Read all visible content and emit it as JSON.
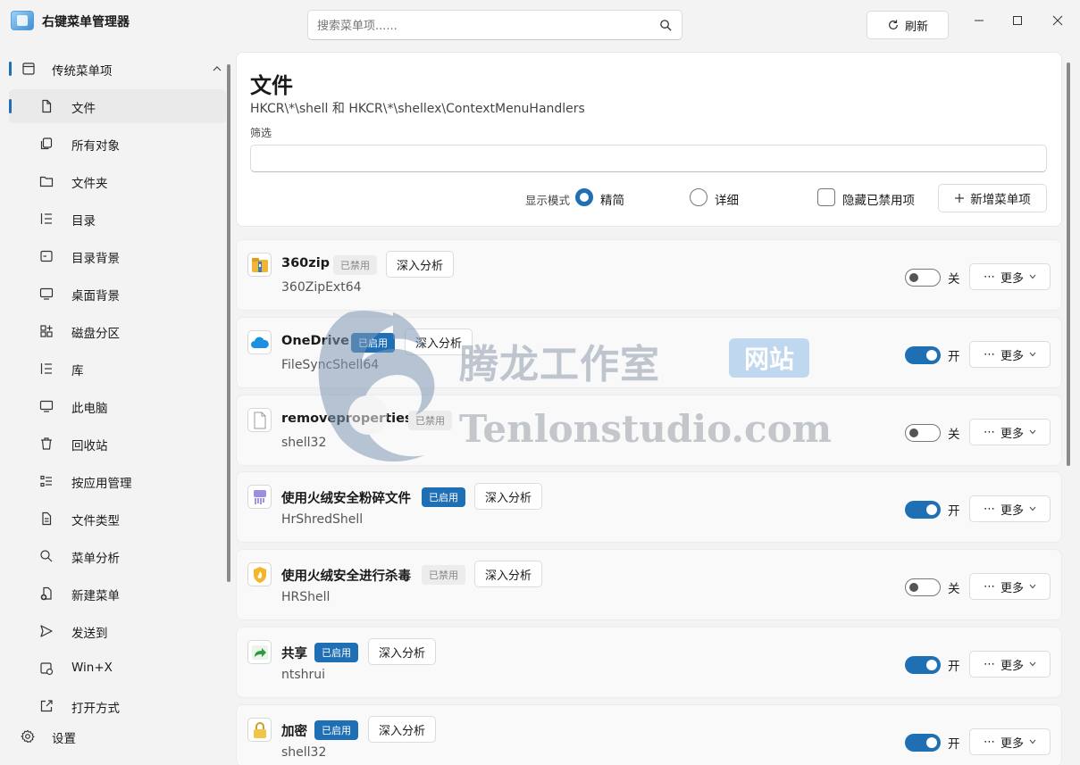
{
  "app": {
    "title": "右键菜单管理器",
    "refresh_label": "刷新"
  },
  "search": {
    "placeholder": "搜索菜单项......"
  },
  "sidebar": {
    "group": "传统菜单项",
    "items": [
      {
        "label": "文件",
        "icon": "file-icon"
      },
      {
        "label": "所有对象",
        "icon": "copy-icon"
      },
      {
        "label": "文件夹",
        "icon": "folder-icon"
      },
      {
        "label": "目录",
        "icon": "list-icon"
      },
      {
        "label": "目录背景",
        "icon": "window-icon"
      },
      {
        "label": "桌面背景",
        "icon": "monitor-icon"
      },
      {
        "label": "磁盘分区",
        "icon": "grid-add-icon"
      },
      {
        "label": "库",
        "icon": "list-icon"
      },
      {
        "label": "此电脑",
        "icon": "monitor-icon"
      },
      {
        "label": "回收站",
        "icon": "trash-icon"
      },
      {
        "label": "按应用管理",
        "icon": "apps-icon"
      },
      {
        "label": "文件类型",
        "icon": "document-icon"
      },
      {
        "label": "菜单分析",
        "icon": "search-icon"
      },
      {
        "label": "新建菜单",
        "icon": "new-document-icon"
      },
      {
        "label": "发送到",
        "icon": "send-icon"
      },
      {
        "label": "Win+X",
        "icon": "settings-window-icon"
      },
      {
        "label": "打开方式",
        "icon": "open-external-icon"
      }
    ],
    "settings": "设置"
  },
  "page": {
    "title": "文件",
    "subtitle": "HKCR\\*\\shell 和 HKCR\\*\\shellex\\ContextMenuHandlers",
    "filter_label": "筛选",
    "filter_value": "",
    "display_mode_label": "显示模式",
    "mode_simple": "精简",
    "mode_detail": "详细",
    "selected_mode": "精简",
    "hide_disabled": "隐藏已禁用项",
    "hide_disabled_checked": false,
    "add_item": "新增菜单项"
  },
  "list": {
    "analyze_label": "深入分析",
    "more_label": "更多",
    "items": [
      {
        "name": "360zip",
        "sub": "360ZipExt64",
        "status": "已禁用",
        "enabled": false,
        "toggle": "关",
        "icon": "archive-icon"
      },
      {
        "name": "OneDrive",
        "sub": "FileSyncShell64",
        "status": "已启用",
        "enabled": true,
        "toggle": "开",
        "icon": "cloud-icon"
      },
      {
        "name": "removeproperties",
        "sub": "shell32",
        "status": "已禁用",
        "enabled": false,
        "toggle": "关",
        "icon": "blank-file-icon"
      },
      {
        "name": "使用火绒安全粉碎文件",
        "sub": "HrShredShell",
        "status": "已启用",
        "enabled": true,
        "toggle": "开",
        "icon": "shredder-icon"
      },
      {
        "name": "使用火绒安全进行杀毒",
        "sub": "HRShell",
        "status": "已禁用",
        "enabled": false,
        "toggle": "关",
        "icon": "flame-shield-icon"
      },
      {
        "name": "共享",
        "sub": "ntshrui",
        "status": "已启用",
        "enabled": true,
        "toggle": "开",
        "icon": "share-arrow-icon"
      },
      {
        "name": "加密",
        "sub": "shell32",
        "status": "已启用",
        "enabled": true,
        "toggle": "开",
        "icon": "lock-icon"
      }
    ]
  },
  "watermark": {
    "cn": "腾龙工作室",
    "badge": "网站",
    "en": "Tenlonstudio.com"
  },
  "colors": {
    "accent": "#1f6fb5",
    "background": "#f3f3f3"
  }
}
